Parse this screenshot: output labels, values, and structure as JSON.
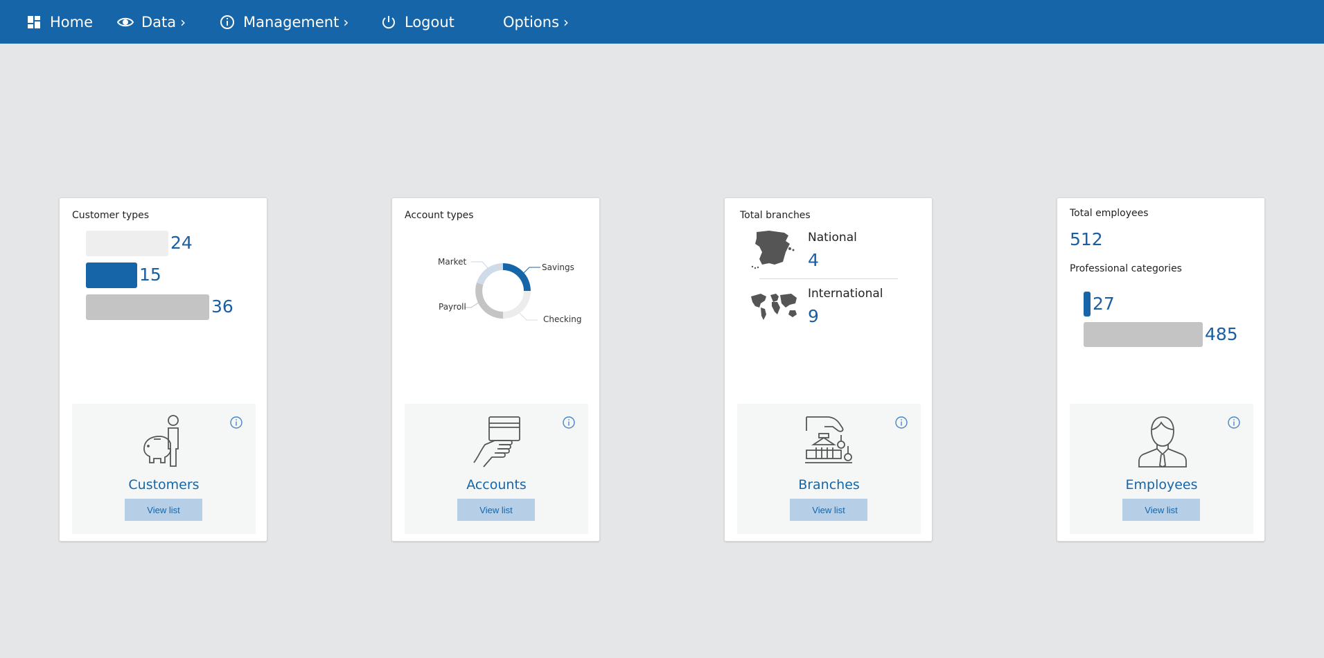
{
  "nav": {
    "home": "Home",
    "data": "Data",
    "management": "Management",
    "logout": "Logout",
    "options": "Options"
  },
  "colors": {
    "primary": "#1565a8",
    "accent_light": "#b7cfe6",
    "bar_gray": "#c4c4c4",
    "bar_light": "#eeeeee"
  },
  "cards": {
    "customers": {
      "title": "Customer types",
      "bars": [
        {
          "value": 24,
          "label": "24",
          "fraction": 0.667,
          "color": "#eeeeee"
        },
        {
          "value": 15,
          "label": "15",
          "fraction": 0.417,
          "color": "#1565a8"
        },
        {
          "value": 36,
          "label": "36",
          "fraction": 1.0,
          "color": "#c4c4c4"
        }
      ],
      "footer_label": "Customers",
      "button": "View list",
      "icon": "piggy-bank-person-icon"
    },
    "accounts": {
      "title": "Account types",
      "donut_labels": {
        "market": "Market",
        "savings": "Savings",
        "payroll": "Payroll",
        "checking": "Checking"
      },
      "footer_label": "Accounts",
      "button": "View list",
      "icon": "hand-card-icon"
    },
    "branches": {
      "title": "Total branches",
      "national_label": "National",
      "national_value": "4",
      "international_label": "International",
      "international_value": "9",
      "footer_label": "Branches",
      "button": "View list",
      "icon": "bank-hand-icon"
    },
    "employees": {
      "title": "Total employees",
      "total": "512",
      "subtitle": "Professional categories",
      "bars": [
        {
          "value": 27,
          "label": "27",
          "fraction": 0.056,
          "color": "#1565a8"
        },
        {
          "value": 485,
          "label": "485",
          "fraction": 1.0,
          "color": "#c4c4c4"
        }
      ],
      "footer_label": "Employees",
      "button": "View list",
      "icon": "businessman-icon"
    }
  },
  "chart_data": [
    {
      "type": "bar",
      "categories": [
        "",
        "",
        ""
      ],
      "values": [
        24,
        15,
        36
      ],
      "title": "Customer types"
    },
    {
      "type": "pie",
      "categories": [
        "Savings",
        "Checking",
        "Payroll",
        "Market"
      ],
      "values": [
        25,
        25,
        30,
        20
      ],
      "title": "Account types"
    },
    {
      "type": "bar",
      "categories": [
        "",
        ""
      ],
      "values": [
        27,
        485
      ],
      "title": "Professional categories"
    }
  ]
}
